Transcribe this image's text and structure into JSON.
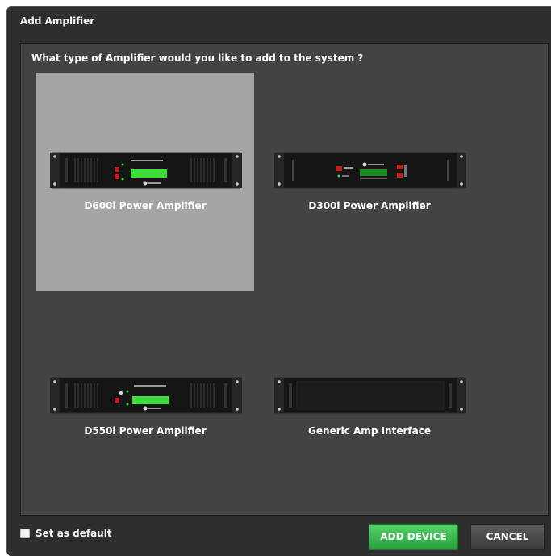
{
  "dialog": {
    "title": "Add Amplifier",
    "question": "What type of Amplifier would you like to add to the system ?"
  },
  "options": [
    {
      "label": "D600i Power Amplifier",
      "icon": "d600i-amplifier-icon",
      "selected": true
    },
    {
      "label": "D300i Power Amplifier",
      "icon": "d300i-amplifier-icon",
      "selected": false
    },
    {
      "label": "D550i Power Amplifier",
      "icon": "d550i-amplifier-icon",
      "selected": false
    },
    {
      "label": "Generic Amp Interface",
      "icon": "generic-amplifier-icon",
      "selected": false
    }
  ],
  "footer": {
    "set_default_label": "Set as default",
    "set_default_checked": false,
    "add_label": "ADD DEVICE",
    "cancel_label": "CANCEL"
  },
  "colors": {
    "dialog_bg": "#2e2e2e",
    "panel_bg": "#434343",
    "selected_tile": "#a5a5a5",
    "add_button": "#3dbb52",
    "lcd_green": "#3ddc3a"
  }
}
